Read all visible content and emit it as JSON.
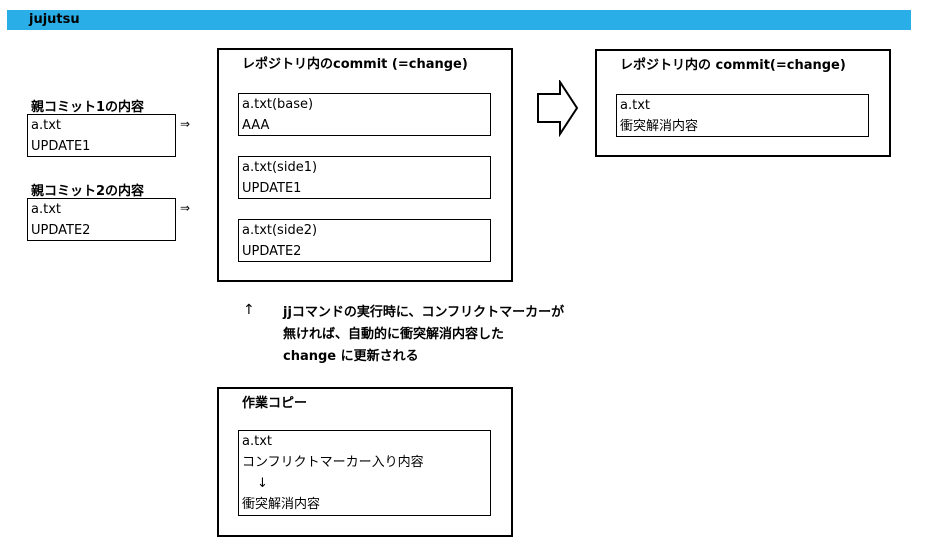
{
  "header": {
    "title": "jujutsu",
    "color": "#29aee8"
  },
  "parent1": {
    "heading": "親コミット1の内容",
    "file": "a.txt",
    "content": "UPDATE1",
    "arrow": "⇒"
  },
  "parent2": {
    "heading": "親コミット2の内容",
    "file": "a.txt",
    "content": "UPDATE2",
    "arrow": "⇒"
  },
  "repo_commit": {
    "title": "レポジトリ内のcommit (=change)",
    "files": [
      {
        "name": "a.txt(base)",
        "content": "AAA"
      },
      {
        "name": "a.txt(side1)",
        "content": "UPDATE1"
      },
      {
        "name": "a.txt(side2)",
        "content": "UPDATE2"
      }
    ]
  },
  "result_commit": {
    "title": "レポジトリ内の commit(=change)",
    "file": "a.txt",
    "content": "衝突解消内容"
  },
  "note": {
    "arrow": "↑",
    "lines": [
      "jjコマンドの実行時に、コンフリクトマーカーが",
      "無ければ、自動的に衝突解消内容した",
      "change に更新される"
    ]
  },
  "working_copy": {
    "title": "作業コピー",
    "file": "a.txt",
    "line1": "コンフリクトマーカー入り内容",
    "arrow": "↓",
    "line2": "衝突解消内容"
  }
}
